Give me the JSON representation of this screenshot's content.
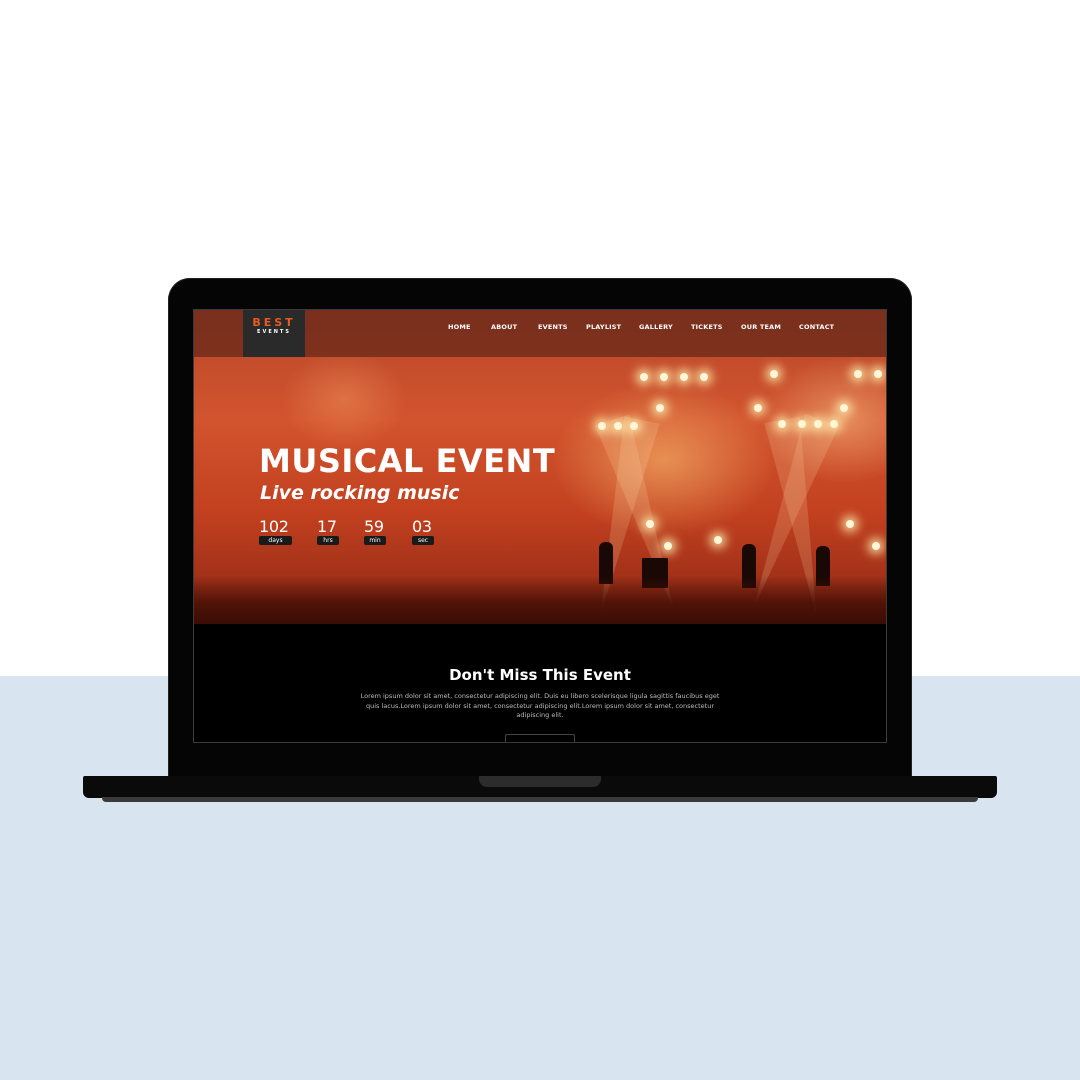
{
  "site": {
    "logo": {
      "top": "BEST",
      "bottom": "EVENTS",
      "accent_color": "#e85a1e"
    },
    "nav": {
      "items": [
        {
          "label": "HOME"
        },
        {
          "label": "ABOUT"
        },
        {
          "label": "EVENTS"
        },
        {
          "label": "PLAYLIST"
        },
        {
          "label": "GALLERY"
        },
        {
          "label": "TICKETS"
        },
        {
          "label": "OUR TEAM"
        },
        {
          "label": "CONTACT"
        }
      ]
    },
    "hero": {
      "title": "MUSICAL EVENT",
      "subtitle": "Live rocking music",
      "countdown": [
        {
          "value": "102",
          "unit": "days"
        },
        {
          "value": "17",
          "unit": "hrs"
        },
        {
          "value": "59",
          "unit": "min"
        },
        {
          "value": "03",
          "unit": "sec"
        }
      ]
    },
    "section": {
      "title": "Don't Miss This Event",
      "text": "Lorem ipsum dolor sit amet, consectetur adipiscing elit. Duis eu libero scelerisque ligula sagittis faucibus eget quis lacus.Lorem ipsum dolor sit amet, consectetur adipiscing elit.Lorem ipsum dolor sit amet, consectetur adipiscing elit."
    }
  },
  "colors": {
    "page_bottom_background": "#d8e4ef",
    "laptop_body": "#050505",
    "hero_tint": "#c2401f"
  }
}
